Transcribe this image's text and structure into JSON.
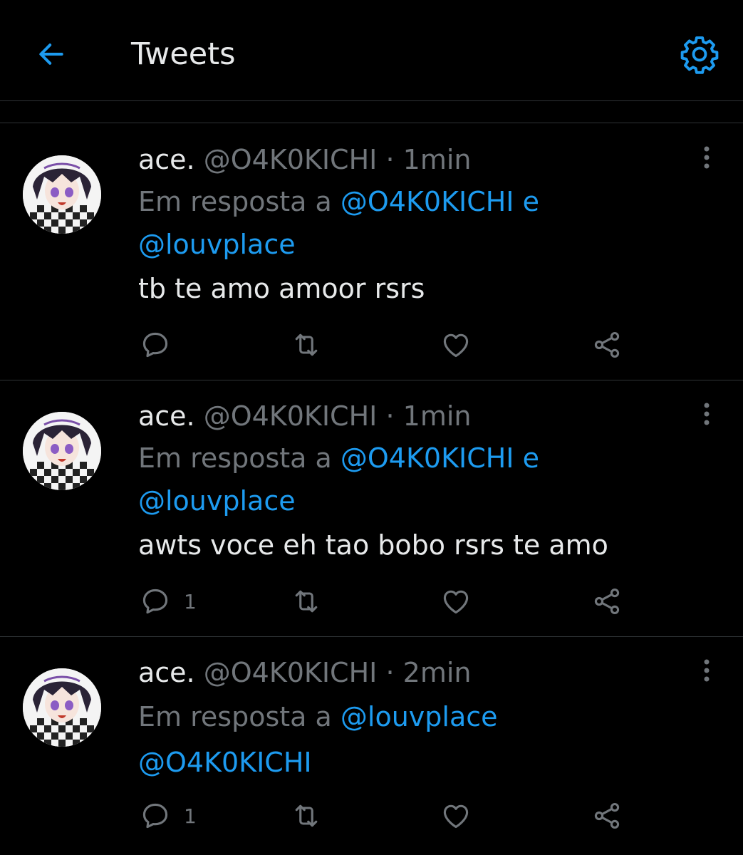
{
  "header": {
    "title": "Tweets",
    "back_icon": "arrow-left-icon",
    "settings_icon": "gear-icon",
    "accent": "#1d9bf0"
  },
  "tweets": [
    {
      "name": "ace.",
      "handle": "@O4K0KICHI",
      "separator": "·",
      "time": "1min",
      "reply_prefix": "Em resposta a",
      "reply_mention_1": "@O4K0KICHI e",
      "reply_mention_2": "@louvplace",
      "text": "tb te amo amoor rsrs",
      "reply_count": ""
    },
    {
      "name": "ace.",
      "handle": "@O4K0KICHI",
      "separator": "·",
      "time": "1min",
      "reply_prefix": "Em resposta a",
      "reply_mention_1": "@O4K0KICHI e",
      "reply_mention_2": "@louvplace",
      "text": "awts voce eh tao bobo rsrs te amo",
      "reply_count": "1"
    },
    {
      "name": "ace.",
      "handle": "@O4K0KICHI",
      "separator": "·",
      "time": "2min",
      "reply_prefix": "Em resposta a",
      "reply_mention_1": "@louvplace",
      "reply_mention_2": "@O4K0KICHI",
      "text": "",
      "reply_count": "1"
    }
  ],
  "colors": {
    "background": "#000000",
    "text": "#e7e9ea",
    "muted": "#71767b",
    "link": "#1d9bf0",
    "divider": "#2f3336"
  }
}
